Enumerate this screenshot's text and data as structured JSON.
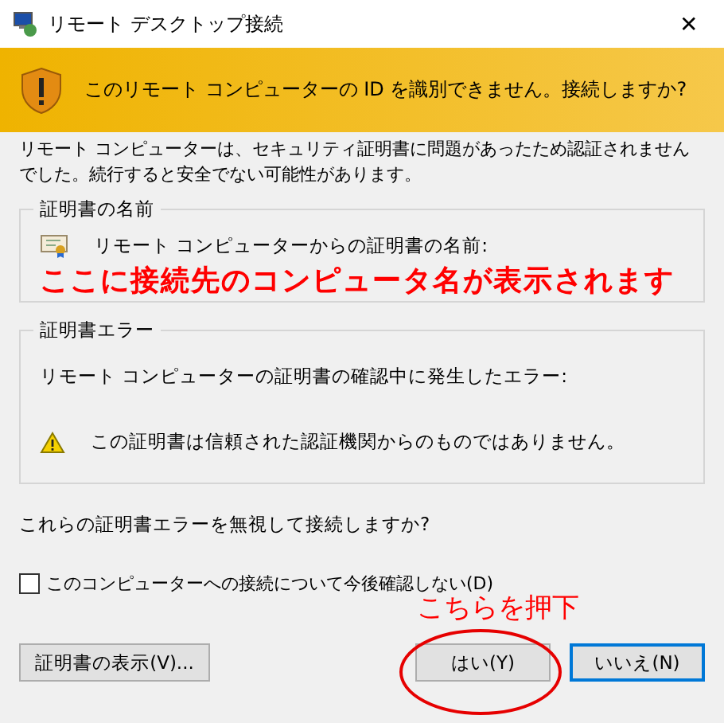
{
  "window": {
    "title": "リモート デスクトップ接続",
    "close": "✕"
  },
  "banner": {
    "message": "このリモート コンピューターの ID を識別できません。接続しますか?"
  },
  "description": "リモート コンピューターは、セキュリティ証明書に問題があったため認証されませんでした。続行すると安全でない可能性があります。",
  "certificate_name_group": {
    "title": "証明書の名前",
    "label": "リモート コンピューターからの証明書の名前:"
  },
  "certificate_error_group": {
    "title": "証明書エラー",
    "intro": "リモート コンピューターの証明書の確認中に発生したエラー:",
    "errors": [
      {
        "text": "この証明書は信頼された認証機関からのものではありません。"
      }
    ]
  },
  "question": "これらの証明書エラーを無視して接続しますか?",
  "checkbox": {
    "label": "このコンピューターへの接続について今後確認しない(D)",
    "checked": false
  },
  "buttons": [
    {
      "label": "証明書の表示(V)...",
      "focused": false
    },
    {
      "label": "はい(Y)",
      "focused": false
    },
    {
      "label": "いいえ(N)",
      "focused": true
    }
  ],
  "annotations": [
    {
      "kind": "note",
      "text": "ここに接続先のコンピュータ名が表示されます"
    },
    {
      "kind": "callout",
      "text": "こちらを押下"
    }
  ]
}
